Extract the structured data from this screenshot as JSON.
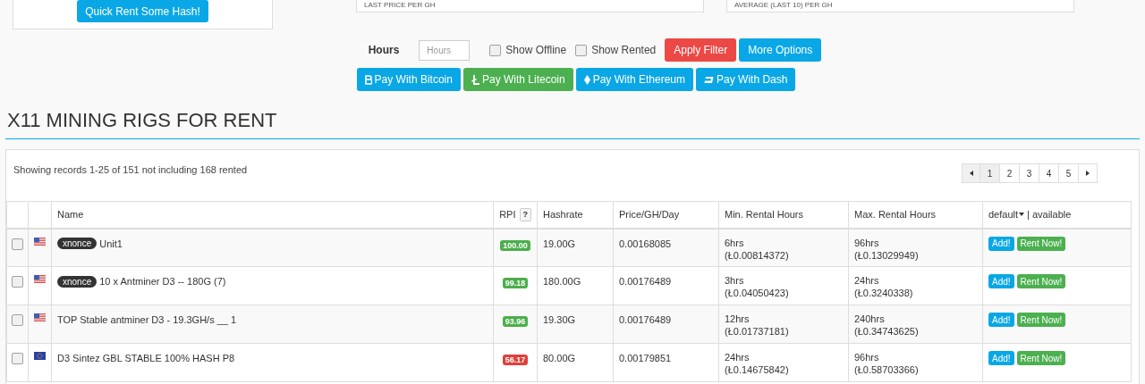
{
  "quick_rent": {
    "button": "Quick Rent Some Hash!"
  },
  "stat_boxes": [
    {
      "label": "LAST PRICE PER GH"
    },
    {
      "label": "AVERAGE (LAST 10) PER GH"
    }
  ],
  "filter": {
    "hours_label": "Hours",
    "hours_placeholder": "Hours",
    "show_offline": {
      "label": "Show Offline",
      "checked": false
    },
    "show_rented": {
      "label": "Show Rented",
      "checked": false
    },
    "apply": "Apply Filter",
    "more": "More Options"
  },
  "pay_buttons": [
    {
      "kind": "bitcoin",
      "label": "Pay With Bitcoin"
    },
    {
      "kind": "litecoin",
      "label": "Pay With Litecoin"
    },
    {
      "kind": "ethereum",
      "label": "Pay With Ethereum"
    },
    {
      "kind": "dash",
      "label": "Pay With Dash"
    }
  ],
  "heading": "X11 MINING RIGS FOR RENT",
  "records_info": "Showing records 1-25 of 151 not including 168 rented",
  "pagination": {
    "pages": [
      {
        "label": "1",
        "selected": true
      },
      {
        "label": "2",
        "selected": false
      },
      {
        "label": "3",
        "selected": false
      },
      {
        "label": "4",
        "selected": false
      },
      {
        "label": "5",
        "selected": false
      }
    ]
  },
  "table": {
    "columns": [
      "Name",
      "RPI",
      "?",
      "Hashrate",
      "Price/GH/Day",
      "Min. Rental Hours",
      "Max. Rental Hours",
      "default",
      "| available"
    ],
    "rows": [
      {
        "checked": false,
        "flag": {
          "kind": "us"
        },
        "tag": "xnonce",
        "name": "Unit1",
        "rpi": {
          "text": "100.00",
          "color": "#4cae4c"
        },
        "hashrate": "19.00G",
        "price": "0.00168085",
        "min_hours": "6hrs",
        "min_cost": "(Ł0.00814372)",
        "max_hours": "96hrs",
        "max_cost": "(Ł0.13029949)",
        "add": "Add!",
        "rent": "Rent Now!"
      },
      {
        "checked": false,
        "flag": {
          "kind": "us"
        },
        "tag": "xnonce",
        "name": "10 x Antminer D3 -- 180G (7)",
        "rpi": {
          "text": "99.18",
          "color": "#4cae4c"
        },
        "hashrate": "180.00G",
        "price": "0.00176489",
        "min_hours": "3hrs",
        "min_cost": "(Ł0.04050423)",
        "max_hours": "24hrs",
        "max_cost": "(Ł0.3240338)",
        "add": "Add!",
        "rent": "Rent Now!"
      },
      {
        "checked": false,
        "flag": {
          "kind": "us"
        },
        "name": "TOP Stable antminer D3 - 19.3GH/s __ 1",
        "rpi": {
          "text": "93.96",
          "color": "#4cae4c"
        },
        "hashrate": "19.30G",
        "price": "0.00176489",
        "min_hours": "12hrs",
        "min_cost": "(Ł0.01737181)",
        "max_hours": "240hrs",
        "max_cost": "(Ł0.34743625)",
        "add": "Add!",
        "rent": "Rent Now!"
      },
      {
        "checked": false,
        "flag": {
          "kind": "eu"
        },
        "name": "D3 Sintez GBL STABLE 100% HASH P8",
        "rpi": {
          "text": "56.17",
          "color": "#e0403a"
        },
        "hashrate": "80.00G",
        "price": "0.00179851",
        "min_hours": "24hrs",
        "min_cost": "(Ł0.14675842)",
        "max_hours": "96hrs",
        "max_cost": "(Ł0.58703366)",
        "add": "Add!",
        "rent": "Rent Now!"
      }
    ]
  }
}
